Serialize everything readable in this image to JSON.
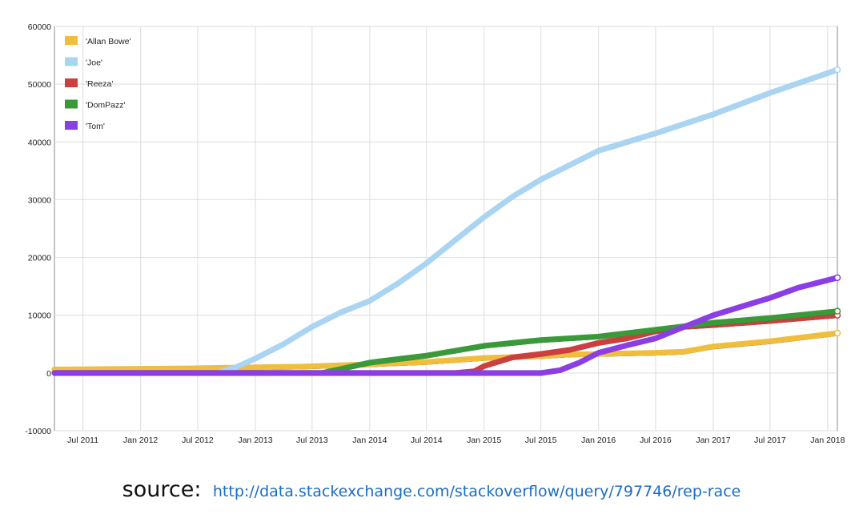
{
  "chart_data": {
    "type": "line",
    "title": "",
    "xlabel": "",
    "ylabel": "",
    "ylim": [
      -10000,
      60000
    ],
    "yticks": [
      -10000,
      0,
      10000,
      20000,
      30000,
      40000,
      50000,
      60000
    ],
    "yticklabels": [
      "-10000",
      "0",
      "10000",
      "20000",
      "30000",
      "40000",
      "50000",
      "60000"
    ],
    "xlim": [
      "2011-04-01",
      "2018-02-01"
    ],
    "xticks": [
      "2011-07-01",
      "2012-01-01",
      "2012-07-01",
      "2013-01-01",
      "2013-07-01",
      "2014-01-01",
      "2014-07-01",
      "2015-01-01",
      "2015-07-01",
      "2016-01-01",
      "2016-07-01",
      "2017-01-01",
      "2017-07-01",
      "2018-01-01"
    ],
    "xticklabels": [
      "Jul 2011",
      "Jan 2012",
      "Jul 2012",
      "Jan 2013",
      "Jul 2013",
      "Jan 2014",
      "Jul 2014",
      "Jan 2015",
      "Jul 2015",
      "Jan 2016",
      "Jul 2016",
      "Jan 2017",
      "Jul 2017",
      "Jan 2018"
    ],
    "grid": true,
    "legend_position": "top-left",
    "series": [
      {
        "name": "'Allan Bowe'",
        "color": "#f0be3c",
        "points": [
          [
            "2011-04-01",
            600
          ],
          [
            "2012-06-01",
            800
          ],
          [
            "2013-06-01",
            1100
          ],
          [
            "2014-01-01",
            1500
          ],
          [
            "2014-07-01",
            1900
          ],
          [
            "2015-01-01",
            2600
          ],
          [
            "2015-07-01",
            2900
          ],
          [
            "2015-10-01",
            3200
          ],
          [
            "2016-01-01",
            3300
          ],
          [
            "2016-07-01",
            3500
          ],
          [
            "2016-10-01",
            3700
          ],
          [
            "2017-01-01",
            4600
          ],
          [
            "2017-07-01",
            5500
          ],
          [
            "2018-02-01",
            6900
          ]
        ]
      },
      {
        "name": "'Joe'",
        "color": "#a9d4f2",
        "points": [
          [
            "2011-04-01",
            0
          ],
          [
            "2012-09-01",
            0
          ],
          [
            "2012-11-01",
            1000
          ],
          [
            "2013-01-01",
            2500
          ],
          [
            "2013-04-01",
            5000
          ],
          [
            "2013-07-01",
            8000
          ],
          [
            "2013-10-01",
            10500
          ],
          [
            "2014-01-01",
            12500
          ],
          [
            "2014-04-01",
            15500
          ],
          [
            "2014-07-01",
            19000
          ],
          [
            "2014-10-01",
            23000
          ],
          [
            "2015-01-01",
            27000
          ],
          [
            "2015-04-01",
            30500
          ],
          [
            "2015-07-01",
            33500
          ],
          [
            "2015-10-01",
            36000
          ],
          [
            "2016-01-01",
            38500
          ],
          [
            "2016-07-01",
            41500
          ],
          [
            "2017-01-01",
            44800
          ],
          [
            "2017-07-01",
            48500
          ],
          [
            "2018-02-01",
            52500
          ]
        ]
      },
      {
        "name": "'Reeza'",
        "color": "#cc3f3f",
        "points": [
          [
            "2011-04-01",
            0
          ],
          [
            "2014-10-01",
            0
          ],
          [
            "2014-12-01",
            300
          ],
          [
            "2015-01-01",
            1200
          ],
          [
            "2015-04-01",
            2700
          ],
          [
            "2015-07-01",
            3300
          ],
          [
            "2015-10-01",
            4000
          ],
          [
            "2016-01-01",
            5200
          ],
          [
            "2016-04-01",
            6000
          ],
          [
            "2016-07-01",
            7200
          ],
          [
            "2016-10-01",
            8000
          ],
          [
            "2017-01-01",
            8300
          ],
          [
            "2017-07-01",
            9000
          ],
          [
            "2018-02-01",
            10000
          ]
        ]
      },
      {
        "name": "'DomPazz'",
        "color": "#3a9a3a",
        "points": [
          [
            "2011-04-01",
            0
          ],
          [
            "2013-08-01",
            0
          ],
          [
            "2013-10-01",
            700
          ],
          [
            "2014-01-01",
            1800
          ],
          [
            "2014-04-01",
            2400
          ],
          [
            "2014-07-01",
            3000
          ],
          [
            "2015-01-01",
            4700
          ],
          [
            "2015-07-01",
            5700
          ],
          [
            "2016-01-01",
            6300
          ],
          [
            "2016-07-01",
            7500
          ],
          [
            "2017-01-01",
            8700
          ],
          [
            "2017-07-01",
            9500
          ],
          [
            "2018-02-01",
            10700
          ]
        ]
      },
      {
        "name": "'Tom'",
        "color": "#8b3ee6",
        "points": [
          [
            "2011-04-01",
            0
          ],
          [
            "2015-07-01",
            0
          ],
          [
            "2015-09-01",
            500
          ],
          [
            "2015-11-01",
            1800
          ],
          [
            "2016-01-01",
            3500
          ],
          [
            "2016-04-01",
            4800
          ],
          [
            "2016-07-01",
            6000
          ],
          [
            "2016-10-01",
            8000
          ],
          [
            "2017-01-01",
            10000
          ],
          [
            "2017-04-01",
            11500
          ],
          [
            "2017-07-01",
            13000
          ],
          [
            "2017-10-01",
            14800
          ],
          [
            "2018-02-01",
            16500
          ]
        ]
      }
    ]
  },
  "source": {
    "label": "source:",
    "link_text": "http://data.stackexchange.com/stackoverflow/query/797746/rep-race"
  }
}
